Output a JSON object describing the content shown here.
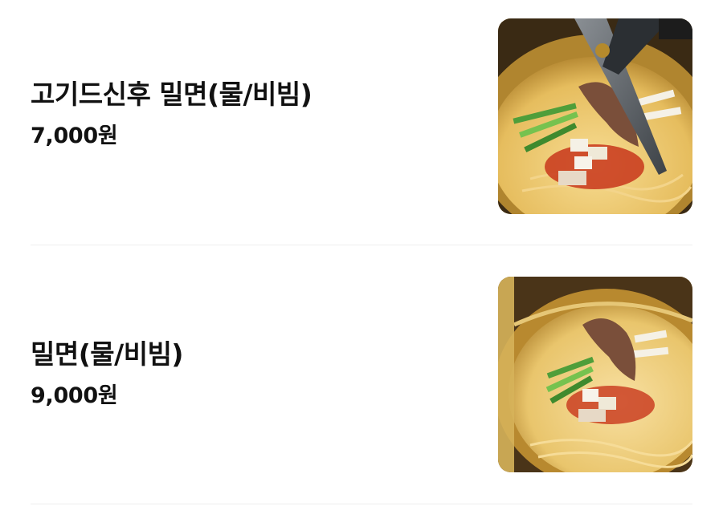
{
  "menu": {
    "items": [
      {
        "name": "고기드신후 밀면(물/비빔)",
        "price": "7,000원",
        "image_icon": "noodle-photo-with-scissors"
      },
      {
        "name": "밀면(물/비빔)",
        "price": "9,000원",
        "image_icon": "noodle-photo"
      }
    ]
  },
  "colors": {
    "text": "#111111",
    "divider": "#eeeeee",
    "broth": "#e9c66e",
    "bowl": "#c99a3a",
    "chili": "#c8361b",
    "cucumber": "#4f9e3a",
    "radish": "#f5f1e6",
    "beef": "#7a4f3a"
  }
}
